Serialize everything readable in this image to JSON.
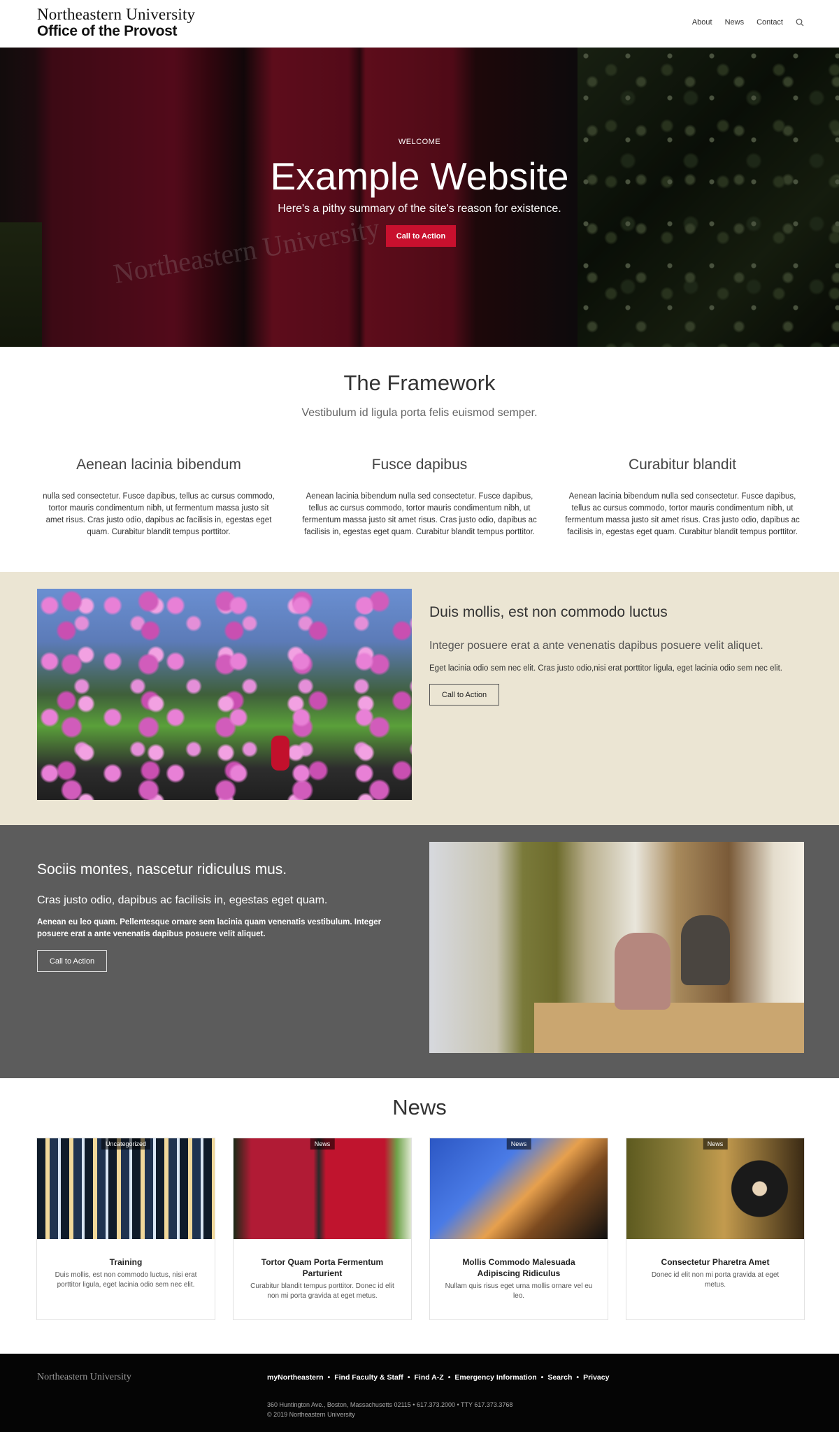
{
  "header": {
    "logo_line1": "Northeastern University",
    "logo_line2": "Office of the Provost",
    "nav": [
      "About",
      "News",
      "Contact"
    ],
    "search_icon": "search-icon"
  },
  "hero": {
    "eyebrow": "WELCOME",
    "title": "Example Website",
    "subtitle": "Here's a pithy summary of the site's reason for existence.",
    "cta": "Call to Action",
    "banner_text": "Northeastern University"
  },
  "framework": {
    "title": "The Framework",
    "subtitle": "Vestibulum id ligula porta felis euismod semper.",
    "columns": [
      {
        "heading": "Aenean lacinia bibendum",
        "body": "nulla sed consectetur. Fusce dapibus, tellus ac cursus commodo, tortor mauris condimentum nibh, ut fermentum massa justo sit amet risus. Cras justo odio, dapibus ac facilisis in, egestas eget quam. Curabitur blandit tempus porttitor."
      },
      {
        "heading": "Fusce dapibus",
        "body": "Aenean lacinia bibendum nulla sed consectetur. Fusce dapibus, tellus ac cursus commodo, tortor mauris condimentum nibh, ut fermentum massa justo sit amet risus. Cras justo odio, dapibus ac facilisis in, egestas eget quam. Curabitur blandit tempus porttitor."
      },
      {
        "heading": "Curabitur blandit",
        "body": "Aenean lacinia bibendum nulla sed consectetur. Fusce dapibus, tellus ac cursus commodo, tortor mauris condimentum nibh, ut fermentum massa justo sit amet risus. Cras justo odio, dapibus ac facilisis in, egestas eget quam. Curabitur blandit tempus porttitor."
      }
    ]
  },
  "feature_beige": {
    "heading": "Duis mollis, est non commodo luctus",
    "subheading": "Integer posuere erat a ante venenatis dapibus posuere velit aliquet.",
    "body": "Eget lacinia odio sem nec elit. Cras justo odio,nisi erat porttitor ligula, eget lacinia odio sem nec elit.",
    "cta": "Call to Action"
  },
  "feature_grey": {
    "heading": "Sociis montes, nascetur ridiculus mus.",
    "subheading": "Cras justo odio, dapibus ac facilisis in, egestas eget quam.",
    "body": "Aenean eu leo quam. Pellentesque ornare sem lacinia quam venenatis vestibulum. Integer posuere erat a ante venenatis dapibus posuere velit aliquet.",
    "cta": "Call to Action"
  },
  "news": {
    "title": "News",
    "cards": [
      {
        "badge": "Uncategorized",
        "title": "Training",
        "excerpt": "Duis mollis, est non commodo luctus, nisi erat porttitor ligula, eget lacinia odio sem nec elit."
      },
      {
        "badge": "News",
        "title": "Tortor Quam Porta Fermentum Parturient",
        "excerpt": "Curabitur blandit tempus porttitor. Donec id elit non mi porta gravida at eget metus."
      },
      {
        "badge": "News",
        "title": "Mollis Commodo Malesuada Adipiscing Ridiculus",
        "excerpt": "Nullam quis risus eget urna mollis ornare vel eu leo."
      },
      {
        "badge": "News",
        "title": "Consectetur Pharetra Amet",
        "excerpt": "Donec id elit non mi porta gravida at eget metus."
      }
    ]
  },
  "footer": {
    "logo": "Northeastern University",
    "links": [
      "myNortheastern",
      "Find Faculty & Staff",
      "Find A-Z",
      "Emergency Information",
      "Search",
      "Privacy"
    ],
    "separator": "•",
    "address": "360 Huntington Ave., Boston, Massachusetts 02115  •  617.373.2000  •  TTY 617.373.3768",
    "copyright": "© 2019 Northeastern University"
  },
  "colors": {
    "accent_red": "#c8102e",
    "beige": "#ebe5d3",
    "grey": "#5c5c5c",
    "footer": "#050505"
  }
}
